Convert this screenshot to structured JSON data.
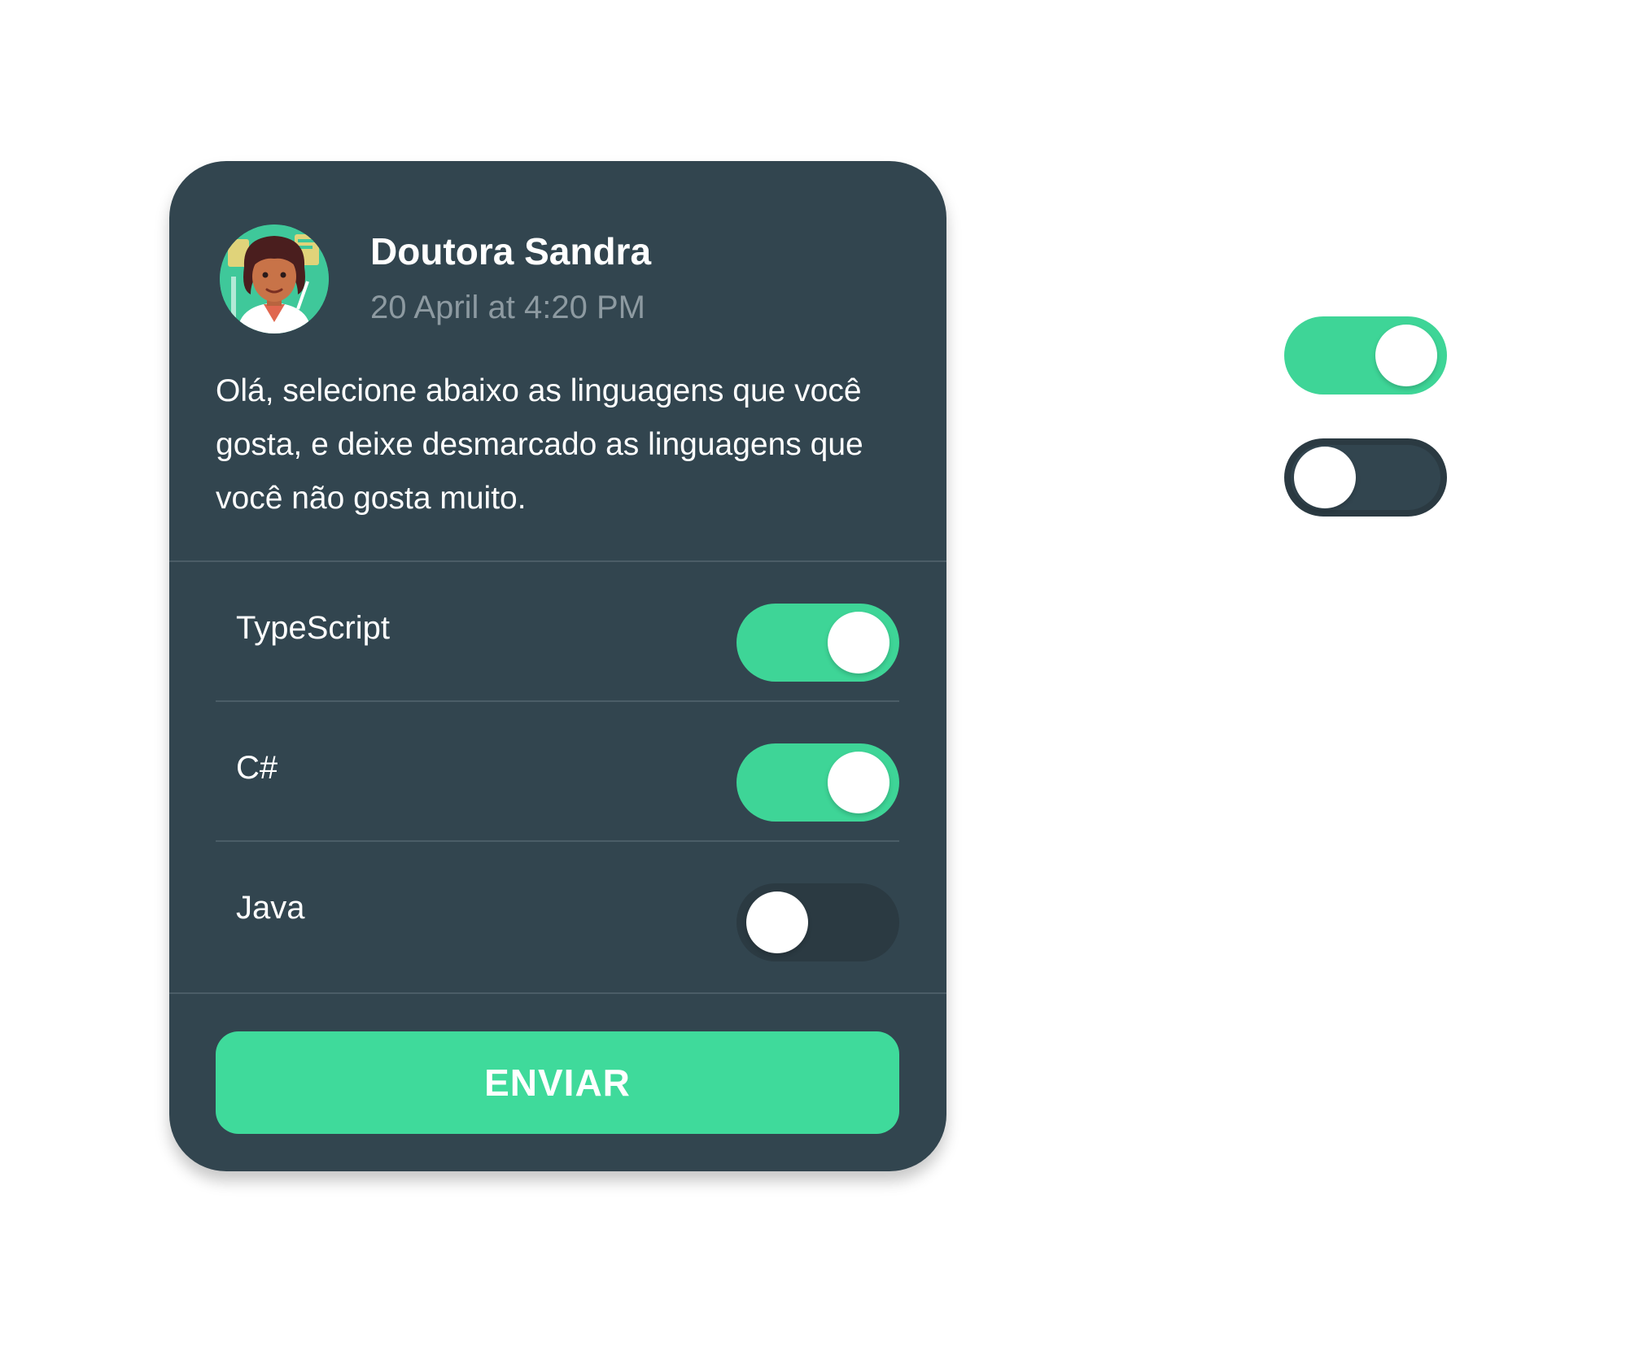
{
  "post": {
    "author_name": "Doutora Sandra",
    "timestamp": "20 April at 4:20 PM",
    "avatar_icon": "doctor-avatar-icon",
    "message": "Olá, selecione abaixo as linguagens que você gosta, e deixe desmarcado as linguagens que você não gosta muito."
  },
  "options": [
    {
      "label": "TypeScript",
      "enabled": true
    },
    {
      "label": "C#",
      "enabled": true
    },
    {
      "label": "Java",
      "enabled": false
    }
  ],
  "submit": {
    "label": "ENVIAR"
  },
  "legend_toggles": [
    {
      "state": "on"
    },
    {
      "state": "off"
    }
  ],
  "colors": {
    "card_background": "#32454f",
    "accent_green": "#3ed597",
    "toggle_off_track": "#2b3a42",
    "muted_text": "#8d9aa1",
    "divider": "#4b5d67"
  }
}
